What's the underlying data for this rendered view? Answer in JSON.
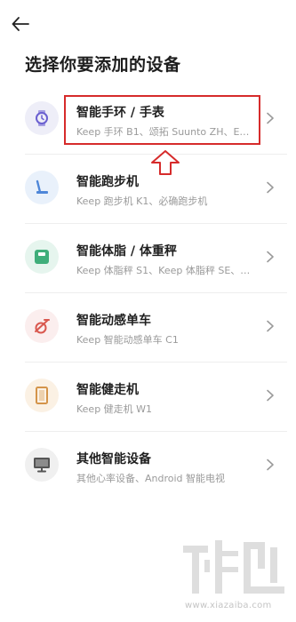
{
  "header": {
    "back_icon": "arrow-left-icon",
    "title": "选择你要添加的设备"
  },
  "devices": [
    {
      "title": "智能手环 / 手表",
      "subtitle": "Keep 手环 B1、颂拓 Suunto ZH、EP…",
      "icon": "watch-icon",
      "icon_bg": "#eeeef8",
      "icon_color": "#6a5fd0"
    },
    {
      "title": "智能跑步机",
      "subtitle": "Keep 跑步机 K1、必确跑步机",
      "icon": "treadmill-icon",
      "icon_bg": "#e9f1fb",
      "icon_color": "#4e86d8"
    },
    {
      "title": "智能体脂 / 体重秤",
      "subtitle": "Keep 体脂秤 S1、Keep 体脂秤 SE、…",
      "icon": "scale-icon",
      "icon_bg": "#e6f5ee",
      "icon_color": "#3fae7a"
    },
    {
      "title": "智能动感单车",
      "subtitle": "Keep 智能动感单车 C1",
      "icon": "bike-icon",
      "icon_bg": "#fbeeee",
      "icon_color": "#d9584f"
    },
    {
      "title": "智能健走机",
      "subtitle": "Keep 健走机 W1",
      "icon": "walking-pad-icon",
      "icon_bg": "#fbf1e4",
      "icon_color": "#d4944a"
    },
    {
      "title": "其他智能设备",
      "subtitle": "其他心率设备、Android 智能电视",
      "icon": "monitor-icon",
      "icon_bg": "#f0f0f0",
      "icon_color": "#555555"
    }
  ],
  "annotation": {
    "highlight_color": "#d62b2b"
  },
  "watermark": {
    "text": "www.xiazaiba.com"
  }
}
